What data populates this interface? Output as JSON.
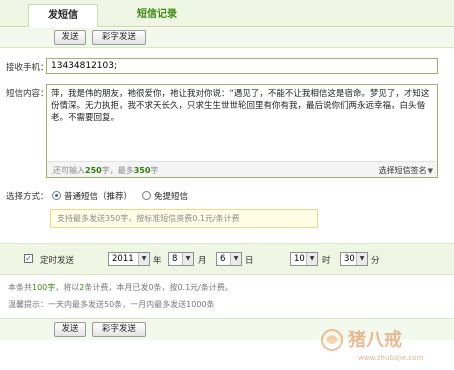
{
  "tabs": {
    "send": "发短信",
    "records": "短信记录"
  },
  "toolbar": {
    "send_label": "发送",
    "colorful_send_label": "彩字发送"
  },
  "recipient": {
    "label": "接收手机：",
    "value": "13434812103;"
  },
  "message": {
    "label": "短信内容：",
    "text": "萍，我是伟的朋友，祂很爱你，祂让我对你说：“遇见了，不能不让我相信这是宿命。梦见了，才知这份情深。无力执拒，我不求天长久，只求生生世世轮回里有你有我，最后说你们两永远幸福，白头偕老。不需要回复。",
    "counter_prefix": "还可输入",
    "remaining": "250",
    "counter_mid": "字，最多",
    "max": "350",
    "counter_suffix": "字",
    "signature_label": "选择短信签名"
  },
  "mode": {
    "label": "选择方式：",
    "normal_label": "普通短信（推荐）",
    "free_label": "免提短信",
    "notice": "支持最多发送350字，按标准短信资费0.1元/条计费"
  },
  "timing": {
    "checkbox_label": "定时发送",
    "year": "2011",
    "year_unit": "年",
    "month": "8",
    "month_unit": "月",
    "day": "6",
    "day_unit": "日",
    "hour": "10",
    "hour_unit": "时",
    "minute": "30",
    "minute_unit": "分"
  },
  "info": {
    "line1_a": "本条共",
    "chars": "100字",
    "line1_b": "，将以",
    "parts": "2",
    "line1_c": "条计费，本月已发0条，按0.1元/条计费。",
    "line2": "温馨提示：一天内最多发送50条，一月内最多发送1000条"
  },
  "bottom": {
    "send_label": "发送",
    "colorful_send_label": "彩字发送"
  },
  "watermark": {
    "text": "猪八戒",
    "url": "www.zhubajie.com"
  },
  "colors": {
    "accent_green": "#3a8a10",
    "tab_bg": "#eef5e2",
    "border_green": "#9ab36a"
  }
}
